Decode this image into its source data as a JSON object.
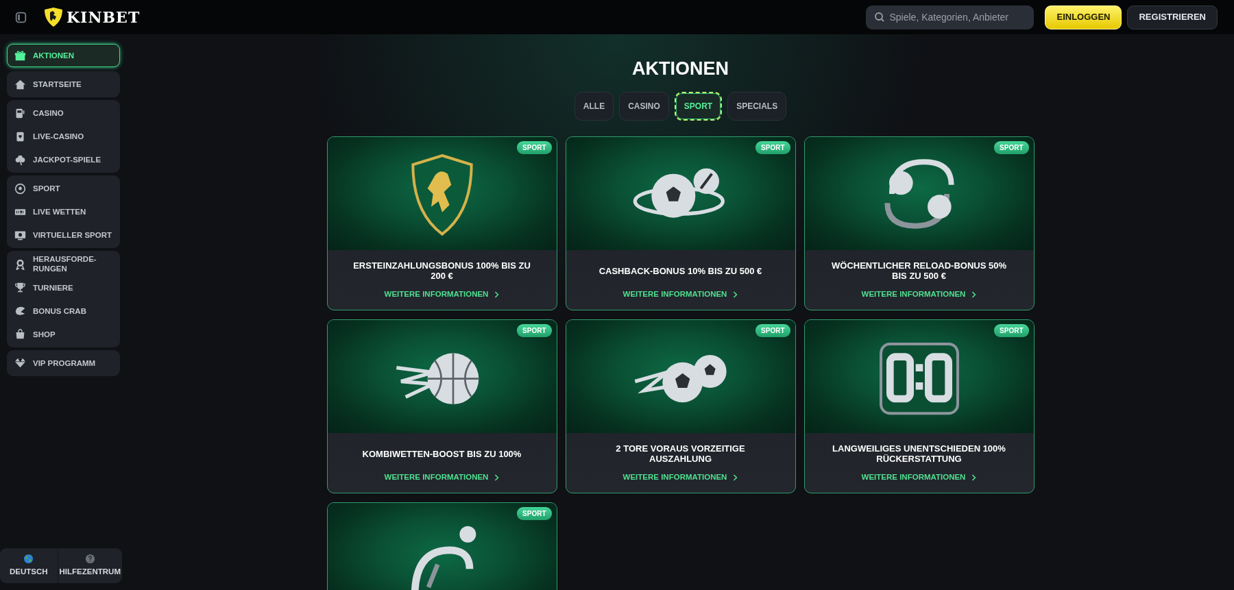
{
  "header": {
    "logo_text": "KINBET",
    "search": {
      "placeholder": "Spiele, Kategorien, Anbieter"
    },
    "buttons": [
      {
        "label": "EINLOGGEN",
        "kind": "primary"
      },
      {
        "label": "REGISTRIEREN",
        "kind": "secondary"
      }
    ]
  },
  "sidebar": {
    "groups": [
      {
        "items": [
          {
            "label": "AKTIONEN",
            "selected": true
          }
        ]
      },
      {
        "items": [
          {
            "label": "STARTSEITE",
            "selected": false
          }
        ]
      },
      {
        "items": [
          {
            "label": "CASINO",
            "selected": false
          },
          {
            "label": "LIVE-CASINO",
            "selected": false
          },
          {
            "label": "JACKPOT-SPIELE",
            "selected": false
          }
        ]
      },
      {
        "items": [
          {
            "label": "SPORT",
            "selected": false
          },
          {
            "label": "LIVE WETTEN",
            "selected": false
          },
          {
            "label": "VIRTUELLER SPORT",
            "selected": false
          }
        ]
      },
      {
        "items": [
          {
            "label": "HERAUSFORDE-RUNGEN",
            "selected": false
          },
          {
            "label": "TURNIERE",
            "selected": false
          },
          {
            "label": "BONUS CRAB",
            "selected": false
          },
          {
            "label": "SHOP",
            "selected": false
          }
        ]
      },
      {
        "items": [
          {
            "label": "VIP PROGRAMM",
            "selected": false
          }
        ]
      }
    ],
    "footer": [
      {
        "label": "DEUTSCH"
      },
      {
        "label": "HILFEZENTRUM"
      }
    ]
  },
  "page": {
    "title": "AKTIONEN",
    "filters": [
      {
        "label": "ALLE",
        "selected": false
      },
      {
        "label": "CASINO",
        "selected": false
      },
      {
        "label": "SPORT",
        "selected": true
      },
      {
        "label": "SPECIALS",
        "selected": false
      }
    ],
    "cards": [
      {
        "tag": "SPORT",
        "title": "ERSTEINZAHLUNGSBONUS 100% BIS ZU 200 €",
        "link": "WEITERE INFORMATIONEN"
      },
      {
        "tag": "SPORT",
        "title": "CASHBACK-BONUS 10% BIS ZU 500 €",
        "link": "WEITERE INFORMATIONEN"
      },
      {
        "tag": "SPORT",
        "title": "WÖCHENTLICHER RELOAD-BONUS 50% BIS ZU 500 €",
        "link": "WEITERE INFORMATIONEN"
      },
      {
        "tag": "SPORT",
        "title": "KOMBIWETTEN-BOOST BIS ZU 100%",
        "link": "WEITERE INFORMATIONEN"
      },
      {
        "tag": "SPORT",
        "title": "2 TORE VORAUS VORZEITIGE AUSZAHLUNG",
        "link": "WEITERE INFORMATIONEN"
      },
      {
        "tag": "SPORT",
        "title": "LANGWEILIGES UNENTSCHIEDEN 100% RÜCKERSTATTUNG",
        "link": "WEITERE INFORMATIONEN"
      },
      {
        "tag": "SPORT"
      }
    ]
  }
}
